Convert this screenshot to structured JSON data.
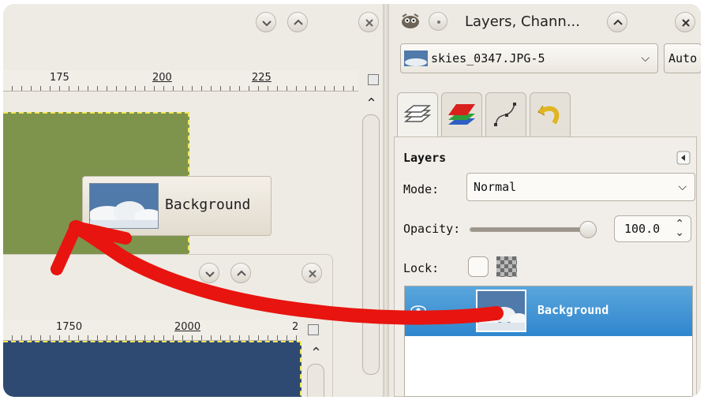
{
  "image_window_top": {
    "ruler_labels": [
      "175",
      "200",
      "225"
    ]
  },
  "image_window_bottom": {
    "ruler_labels": [
      "1750",
      "2000",
      "2"
    ]
  },
  "drag_tooltip": {
    "layer_name": "Background"
  },
  "dock": {
    "title": "Layers, Chann...",
    "image_selector": {
      "value": "skies_0347.JPG-5"
    },
    "auto_button": "Auto",
    "tabs": [
      "layers-tab",
      "channels-tab",
      "paths-tab",
      "undo-history-tab"
    ],
    "panel": {
      "title": "Layers",
      "mode_label": "Mode:",
      "mode_value": "Normal",
      "opacity_label": "Opacity:",
      "opacity_value": "100.0",
      "opacity_fraction": 1.0,
      "lock_label": "Lock:",
      "layers": [
        {
          "name": "Background",
          "selected": true,
          "visible": true
        }
      ]
    }
  },
  "annotation": {
    "arrow_color": "#e8140f"
  },
  "colors": {
    "selection": "#3a8fd3",
    "canvas_green": "#7e934c",
    "canvas_blue": "#2e4a72",
    "marching_ants": "#f2e65a"
  }
}
